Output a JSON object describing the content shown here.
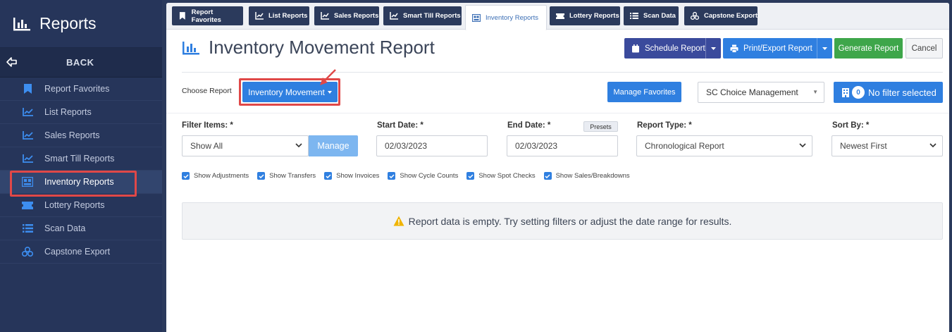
{
  "sidebar": {
    "title": "Reports",
    "back_label": "BACK",
    "items": [
      {
        "label": "Report Favorites",
        "icon": "bookmark-icon"
      },
      {
        "label": "List Reports",
        "icon": "chart-line-icon"
      },
      {
        "label": "Sales Reports",
        "icon": "chart-line-icon"
      },
      {
        "label": "Smart Till Reports",
        "icon": "chart-line-icon"
      },
      {
        "label": "Inventory Reports",
        "icon": "inventory-icon"
      },
      {
        "label": "Lottery Reports",
        "icon": "ticket-icon"
      },
      {
        "label": "Scan Data",
        "icon": "list-icon"
      },
      {
        "label": "Capstone Export",
        "icon": "cubes-icon"
      }
    ]
  },
  "tabs": [
    {
      "label": "Report Favorites"
    },
    {
      "label": "List Reports"
    },
    {
      "label": "Sales Reports"
    },
    {
      "label": "Smart Till Reports"
    },
    {
      "label": "Inventory Reports"
    },
    {
      "label": "Lottery Reports"
    },
    {
      "label": "Scan Data"
    },
    {
      "label": "Capstone Export"
    }
  ],
  "header": {
    "title": "Inventory Movement Report",
    "schedule_label": "Schedule Report",
    "print_label": "Print/Export Report",
    "generate_label": "Generate Report",
    "cancel_label": "Cancel"
  },
  "choose": {
    "label": "Choose Report",
    "selected_report": "Inventory Movement",
    "manage_favorites_label": "Manage Favorites",
    "company": "SC Choice Management",
    "filter_count": "0",
    "filter_label": "No filter selected"
  },
  "filters": {
    "filter_items_label": "Filter Items: *",
    "filter_items_value": "Show All",
    "manage_label": "Manage",
    "start_date_label": "Start Date: *",
    "start_date": "02/03/2023",
    "end_date_label": "End Date: *",
    "presets_label": "Presets",
    "end_date": "02/03/2023",
    "report_type_label": "Report Type: *",
    "report_type": "Chronological Report",
    "sort_by_label": "Sort By: *",
    "sort_by": "Newest First"
  },
  "checkboxes": [
    {
      "label": "Show Adjustments",
      "checked": true
    },
    {
      "label": "Show Transfers",
      "checked": true
    },
    {
      "label": "Show Invoices",
      "checked": true
    },
    {
      "label": "Show Cycle Counts",
      "checked": true
    },
    {
      "label": "Show Spot Checks",
      "checked": true
    },
    {
      "label": "Show Sales/Breakdowns",
      "checked": true
    }
  ],
  "empty_message": "Report data is empty. Try setting filters or adjust the date range for results.",
  "colors": {
    "sidebar": "#26355a",
    "primary": "#2f7fe0",
    "schedule": "#3a4a9c",
    "generate": "#3ea64a",
    "annotation": "#e04848"
  }
}
